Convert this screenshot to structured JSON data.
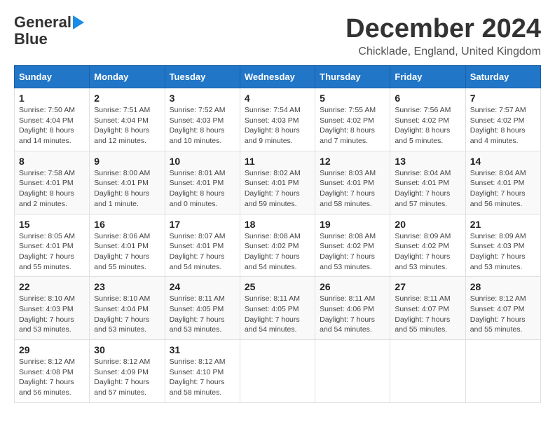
{
  "logo": {
    "line1": "General",
    "line2": "Blue"
  },
  "header": {
    "title": "December 2024",
    "subtitle": "Chicklade, England, United Kingdom"
  },
  "weekdays": [
    "Sunday",
    "Monday",
    "Tuesday",
    "Wednesday",
    "Thursday",
    "Friday",
    "Saturday"
  ],
  "weeks": [
    [
      {
        "day": "1",
        "sunrise": "Sunrise: 7:50 AM",
        "sunset": "Sunset: 4:04 PM",
        "daylight": "Daylight: 8 hours and 14 minutes."
      },
      {
        "day": "2",
        "sunrise": "Sunrise: 7:51 AM",
        "sunset": "Sunset: 4:04 PM",
        "daylight": "Daylight: 8 hours and 12 minutes."
      },
      {
        "day": "3",
        "sunrise": "Sunrise: 7:52 AM",
        "sunset": "Sunset: 4:03 PM",
        "daylight": "Daylight: 8 hours and 10 minutes."
      },
      {
        "day": "4",
        "sunrise": "Sunrise: 7:54 AM",
        "sunset": "Sunset: 4:03 PM",
        "daylight": "Daylight: 8 hours and 9 minutes."
      },
      {
        "day": "5",
        "sunrise": "Sunrise: 7:55 AM",
        "sunset": "Sunset: 4:02 PM",
        "daylight": "Daylight: 8 hours and 7 minutes."
      },
      {
        "day": "6",
        "sunrise": "Sunrise: 7:56 AM",
        "sunset": "Sunset: 4:02 PM",
        "daylight": "Daylight: 8 hours and 5 minutes."
      },
      {
        "day": "7",
        "sunrise": "Sunrise: 7:57 AM",
        "sunset": "Sunset: 4:02 PM",
        "daylight": "Daylight: 8 hours and 4 minutes."
      }
    ],
    [
      {
        "day": "8",
        "sunrise": "Sunrise: 7:58 AM",
        "sunset": "Sunset: 4:01 PM",
        "daylight": "Daylight: 8 hours and 2 minutes."
      },
      {
        "day": "9",
        "sunrise": "Sunrise: 8:00 AM",
        "sunset": "Sunset: 4:01 PM",
        "daylight": "Daylight: 8 hours and 1 minute."
      },
      {
        "day": "10",
        "sunrise": "Sunrise: 8:01 AM",
        "sunset": "Sunset: 4:01 PM",
        "daylight": "Daylight: 8 hours and 0 minutes."
      },
      {
        "day": "11",
        "sunrise": "Sunrise: 8:02 AM",
        "sunset": "Sunset: 4:01 PM",
        "daylight": "Daylight: 7 hours and 59 minutes."
      },
      {
        "day": "12",
        "sunrise": "Sunrise: 8:03 AM",
        "sunset": "Sunset: 4:01 PM",
        "daylight": "Daylight: 7 hours and 58 minutes."
      },
      {
        "day": "13",
        "sunrise": "Sunrise: 8:04 AM",
        "sunset": "Sunset: 4:01 PM",
        "daylight": "Daylight: 7 hours and 57 minutes."
      },
      {
        "day": "14",
        "sunrise": "Sunrise: 8:04 AM",
        "sunset": "Sunset: 4:01 PM",
        "daylight": "Daylight: 7 hours and 56 minutes."
      }
    ],
    [
      {
        "day": "15",
        "sunrise": "Sunrise: 8:05 AM",
        "sunset": "Sunset: 4:01 PM",
        "daylight": "Daylight: 7 hours and 55 minutes."
      },
      {
        "day": "16",
        "sunrise": "Sunrise: 8:06 AM",
        "sunset": "Sunset: 4:01 PM",
        "daylight": "Daylight: 7 hours and 55 minutes."
      },
      {
        "day": "17",
        "sunrise": "Sunrise: 8:07 AM",
        "sunset": "Sunset: 4:01 PM",
        "daylight": "Daylight: 7 hours and 54 minutes."
      },
      {
        "day": "18",
        "sunrise": "Sunrise: 8:08 AM",
        "sunset": "Sunset: 4:02 PM",
        "daylight": "Daylight: 7 hours and 54 minutes."
      },
      {
        "day": "19",
        "sunrise": "Sunrise: 8:08 AM",
        "sunset": "Sunset: 4:02 PM",
        "daylight": "Daylight: 7 hours and 53 minutes."
      },
      {
        "day": "20",
        "sunrise": "Sunrise: 8:09 AM",
        "sunset": "Sunset: 4:02 PM",
        "daylight": "Daylight: 7 hours and 53 minutes."
      },
      {
        "day": "21",
        "sunrise": "Sunrise: 8:09 AM",
        "sunset": "Sunset: 4:03 PM",
        "daylight": "Daylight: 7 hours and 53 minutes."
      }
    ],
    [
      {
        "day": "22",
        "sunrise": "Sunrise: 8:10 AM",
        "sunset": "Sunset: 4:03 PM",
        "daylight": "Daylight: 7 hours and 53 minutes."
      },
      {
        "day": "23",
        "sunrise": "Sunrise: 8:10 AM",
        "sunset": "Sunset: 4:04 PM",
        "daylight": "Daylight: 7 hours and 53 minutes."
      },
      {
        "day": "24",
        "sunrise": "Sunrise: 8:11 AM",
        "sunset": "Sunset: 4:05 PM",
        "daylight": "Daylight: 7 hours and 53 minutes."
      },
      {
        "day": "25",
        "sunrise": "Sunrise: 8:11 AM",
        "sunset": "Sunset: 4:05 PM",
        "daylight": "Daylight: 7 hours and 54 minutes."
      },
      {
        "day": "26",
        "sunrise": "Sunrise: 8:11 AM",
        "sunset": "Sunset: 4:06 PM",
        "daylight": "Daylight: 7 hours and 54 minutes."
      },
      {
        "day": "27",
        "sunrise": "Sunrise: 8:11 AM",
        "sunset": "Sunset: 4:07 PM",
        "daylight": "Daylight: 7 hours and 55 minutes."
      },
      {
        "day": "28",
        "sunrise": "Sunrise: 8:12 AM",
        "sunset": "Sunset: 4:07 PM",
        "daylight": "Daylight: 7 hours and 55 minutes."
      }
    ],
    [
      {
        "day": "29",
        "sunrise": "Sunrise: 8:12 AM",
        "sunset": "Sunset: 4:08 PM",
        "daylight": "Daylight: 7 hours and 56 minutes."
      },
      {
        "day": "30",
        "sunrise": "Sunrise: 8:12 AM",
        "sunset": "Sunset: 4:09 PM",
        "daylight": "Daylight: 7 hours and 57 minutes."
      },
      {
        "day": "31",
        "sunrise": "Sunrise: 8:12 AM",
        "sunset": "Sunset: 4:10 PM",
        "daylight": "Daylight: 7 hours and 58 minutes."
      },
      null,
      null,
      null,
      null
    ]
  ]
}
